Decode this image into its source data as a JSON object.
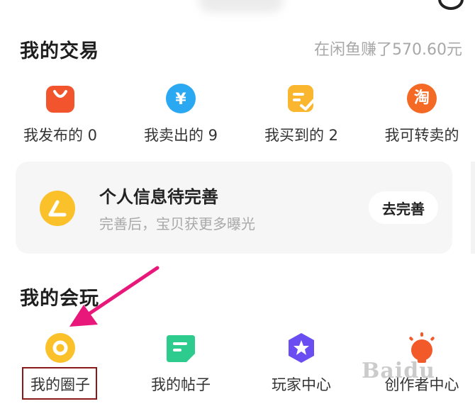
{
  "trade": {
    "title": "我的交易",
    "earnings": "在闲鱼赚了570.60元",
    "items": [
      {
        "label": "我发布的 0",
        "icon": "shopping-bag-icon",
        "color": "#f2542d"
      },
      {
        "label": "我卖出的 9",
        "icon": "yuan-icon",
        "color": "#2aa8f2"
      },
      {
        "label": "我买到的 2",
        "icon": "checked-list-icon",
        "color": "#fbb630"
      },
      {
        "label": "我可转卖的",
        "icon": "taobao-icon",
        "color": "#f46a24",
        "glyph": "淘"
      }
    ]
  },
  "profile_card": {
    "title": "个人信息待完善",
    "subtitle": "完善后，宝贝获更多曝光",
    "button": "去完善",
    "icon": "edit-pen-icon",
    "color": "#fbc12b"
  },
  "play": {
    "title": "我的会玩",
    "items": [
      {
        "label": "我的圈子",
        "icon": "circle-icon",
        "color": "#fbc12b"
      },
      {
        "label": "我的帖子",
        "icon": "post-icon",
        "color": "#2ecb8f"
      },
      {
        "label": "玩家中心",
        "icon": "star-hexagon-icon",
        "color": "#6a4ef2"
      },
      {
        "label": "创作者中心",
        "icon": "bulb-icon",
        "color": "#f35a2a"
      }
    ]
  },
  "annotation": {
    "arrow_color": "#e8187a",
    "box_color": "#8a1a1a"
  },
  "watermark": "Baidu"
}
